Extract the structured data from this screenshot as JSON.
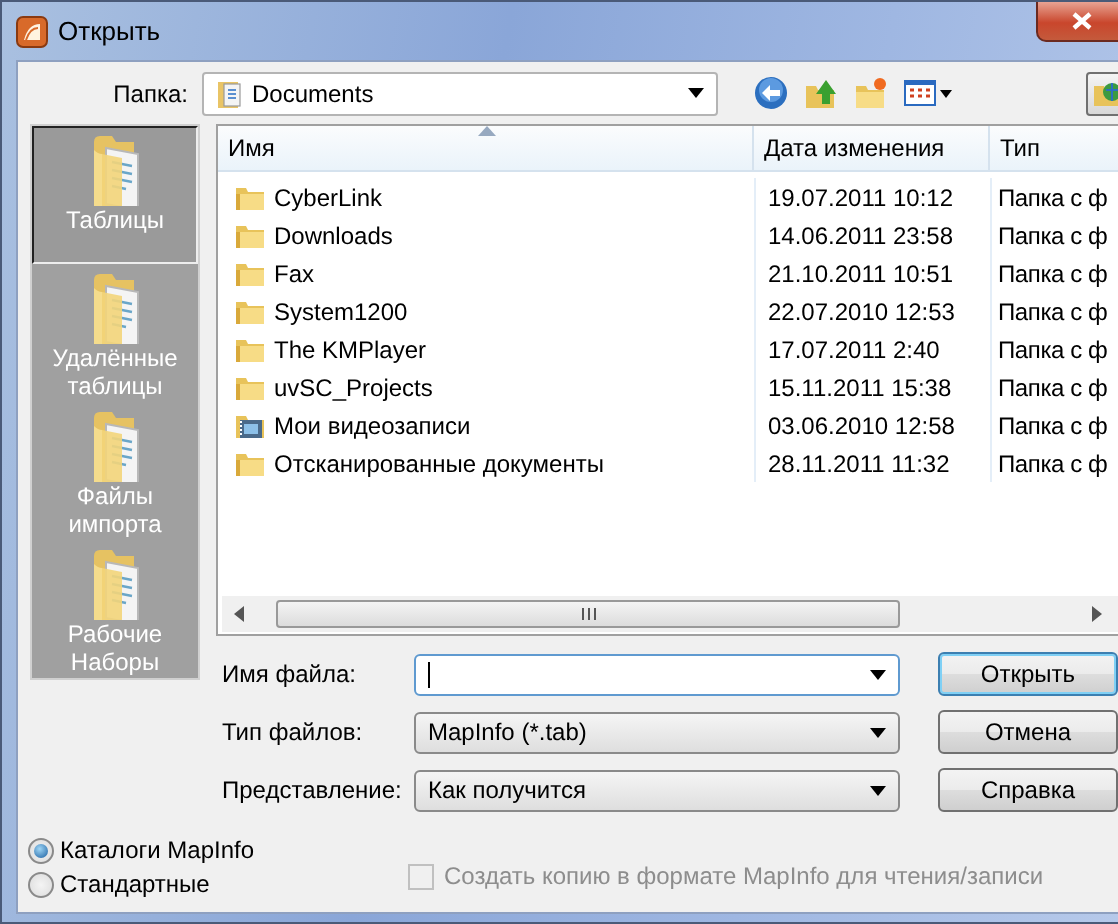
{
  "window": {
    "title": "Открыть"
  },
  "folder_bar": {
    "label": "Папка:",
    "value": "Documents"
  },
  "places": [
    {
      "label": "Таблицы",
      "selected": true
    },
    {
      "label": "Удалённые таблицы",
      "selected": false
    },
    {
      "label": "Файлы импорта",
      "selected": false
    },
    {
      "label": "Рабочие Наборы",
      "selected": false
    }
  ],
  "file_list": {
    "columns": [
      "Имя",
      "Дата изменения",
      "Тип"
    ],
    "rows": [
      {
        "kind": "folder",
        "name": "CyberLink",
        "date": "19.07.2011 10:12",
        "type": "Папка с ф"
      },
      {
        "kind": "folder",
        "name": "Downloads",
        "date": "14.06.2011 23:58",
        "type": "Папка с ф"
      },
      {
        "kind": "folder",
        "name": "Fax",
        "date": "21.10.2011 10:51",
        "type": "Папка с ф"
      },
      {
        "kind": "folder",
        "name": "System1200",
        "date": "22.07.2010 12:53",
        "type": "Папка с ф"
      },
      {
        "kind": "folder",
        "name": "The KMPlayer",
        "date": "17.07.2011 2:40",
        "type": "Папка с ф"
      },
      {
        "kind": "folder",
        "name": "uvSC_Projects",
        "date": "15.11.2011 15:38",
        "type": "Папка с ф"
      },
      {
        "kind": "video",
        "name": "Мои видеозаписи",
        "date": "03.06.2010 12:58",
        "type": "Папка с ф"
      },
      {
        "kind": "folder",
        "name": "Отсканированные документы",
        "date": "28.11.2011 11:32",
        "type": "Папка с ф"
      }
    ]
  },
  "fields": [
    {
      "label": "Имя файла:",
      "focused": true
    },
    {
      "label": "Тип файлов:",
      "value": "MapInfo (*.tab)"
    },
    {
      "label": "Представление:",
      "value": "Как получится"
    }
  ],
  "buttons": [
    {
      "label": "Открыть",
      "default": true
    },
    {
      "label": "Отмена",
      "default": false
    },
    {
      "label": "Справка",
      "default": false
    }
  ],
  "checkbox": {
    "label": "Создать копию в формате MapInfo для чтения/записи",
    "checked": false,
    "disabled": true
  },
  "radios": [
    {
      "label": "Каталоги MapInfo",
      "selected": true
    },
    {
      "label": "Стандартные",
      "selected": false
    }
  ]
}
